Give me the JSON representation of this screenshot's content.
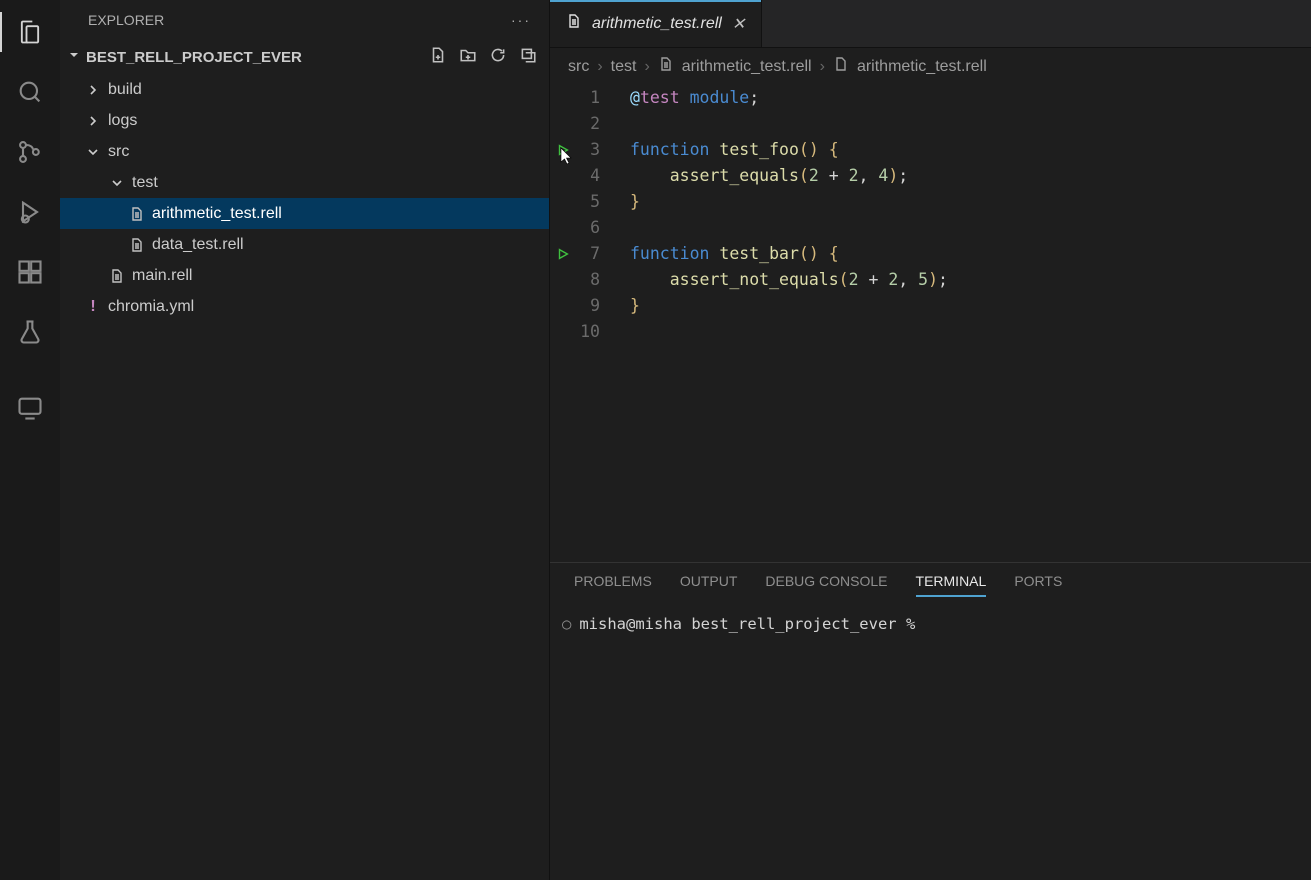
{
  "sidebar": {
    "title": "EXPLORER",
    "project": "BEST_RELL_PROJECT_EVER",
    "tree": {
      "build": "build",
      "logs": "logs",
      "src": "src",
      "test": "test",
      "arithmetic": "arithmetic_test.rell",
      "data": "data_test.rell",
      "main": "main.rell",
      "chromia": "chromia.yml"
    }
  },
  "tab": {
    "label": "arithmetic_test.rell"
  },
  "breadcrumb": {
    "a": "src",
    "b": "test",
    "c": "arithmetic_test.rell",
    "d": "arithmetic_test.rell"
  },
  "code": {
    "l1_at": "@",
    "l1_test": "test",
    "l1_mod": " module",
    "l1_semi": ";",
    "l3_fn": "function",
    "l3_name": " test_foo",
    "l3_p_open": "(",
    "l3_p_close": ")",
    "l3_sp": " ",
    "l3_brace": "{",
    "l4_indent": "    ",
    "l4_call": "assert_equals",
    "l4_p_open": "(",
    "l4_n1": "2",
    "l4_plus": " + ",
    "l4_n2": "2",
    "l4_comma": ", ",
    "l4_n3": "4",
    "l4_p_close": ")",
    "l4_semi": ";",
    "l5_brace": "}",
    "l7_fn": "function",
    "l7_name": " test_bar",
    "l7_p_open": "(",
    "l7_p_close": ")",
    "l7_sp": " ",
    "l7_brace": "{",
    "l8_indent": "    ",
    "l8_call": "assert_not_equals",
    "l8_p_open": "(",
    "l8_n1": "2",
    "l8_plus": " + ",
    "l8_n2": "2",
    "l8_comma": ", ",
    "l8_n3": "5",
    "l8_p_close": ")",
    "l8_semi": ";",
    "l9_brace": "}"
  },
  "lines": {
    "n1": "1",
    "n2": "2",
    "n3": "3",
    "n4": "4",
    "n5": "5",
    "n6": "6",
    "n7": "7",
    "n8": "8",
    "n9": "9",
    "n10": "10"
  },
  "panel": {
    "problems": "PROBLEMS",
    "output": "OUTPUT",
    "debug": "DEBUG CONSOLE",
    "terminal": "TERMINAL",
    "ports": "PORTS"
  },
  "terminal": {
    "prompt": "misha@misha best_rell_project_ever % "
  }
}
